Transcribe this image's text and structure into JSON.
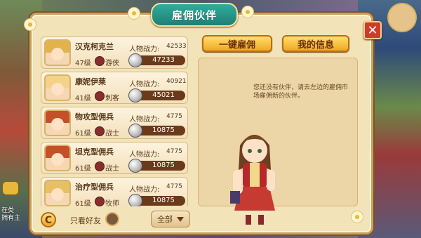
{
  "window": {
    "title": "雇佣伙伴"
  },
  "buttons": {
    "hire_all": "一键雇佣",
    "my_info": "我的信息",
    "close": "✕",
    "refresh": "C"
  },
  "message": "您还没有伙伴，请去左边的雇佣市场雇佣新的伙伴。",
  "list": [
    {
      "name": "汉克柯克兰",
      "level": "47级",
      "class": "游侠",
      "power_label": "人物战力:",
      "power": "42533",
      "cost": "47233",
      "hair_color": "#e2b34a"
    },
    {
      "name": "康妮伊莱",
      "level": "41级",
      "class": "刺客",
      "power_label": "人物战力:",
      "power": "40921",
      "cost": "45021",
      "hair_color": "#f3d38a"
    },
    {
      "name": "物攻型佣兵",
      "level": "61级",
      "class": "战士",
      "power_label": "人物战力:",
      "power": "4775",
      "cost": "10875",
      "hair_color": "#c4502a"
    },
    {
      "name": "坦克型佣兵",
      "level": "61级",
      "class": "战士",
      "power_label": "人物战力:",
      "power": "4775",
      "cost": "10875",
      "hair_color": "#c4502a"
    },
    {
      "name": "治疗型佣兵",
      "level": "61级",
      "class": "牧师",
      "power_label": "人物战力:",
      "power": "4775",
      "cost": "10875",
      "hair_color": "#e7c064"
    }
  ],
  "bottom": {
    "friends_only": "只看好友",
    "filter": "全部"
  },
  "hud": {
    "line1": "在类",
    "line2": "拥有主"
  },
  "colors": {
    "panel_bg": "#f3e3b8",
    "title_bg": "#1f7f77",
    "gold_button": "#f1a823",
    "close_red": "#d03a2a"
  }
}
